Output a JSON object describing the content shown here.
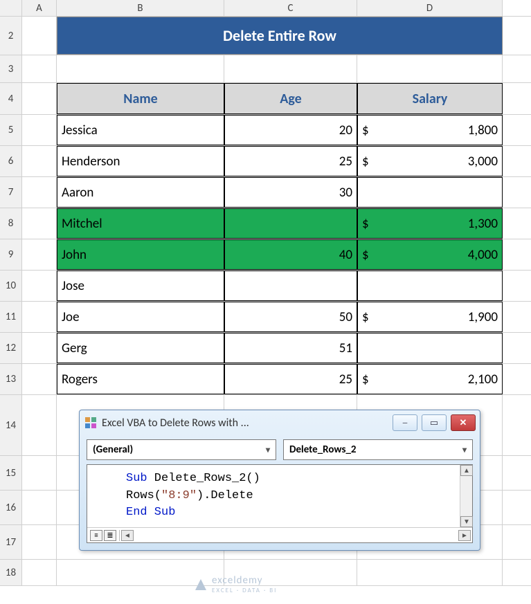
{
  "columns": {
    "a": "A",
    "b": "B",
    "c": "C",
    "d": "D"
  },
  "rowLabels": {
    "r2": "2",
    "r3": "3",
    "r4": "4",
    "r5": "5",
    "r6": "6",
    "r7": "7",
    "r8": "8",
    "r9": "9",
    "r10": "10",
    "r11": "11",
    "r12": "12",
    "r13": "13",
    "r14": "14",
    "r15": "15",
    "r16": "16",
    "r17": "17",
    "r18": "18"
  },
  "title": "Delete Entire Row",
  "headers": {
    "name": "Name",
    "age": "Age",
    "salary": "Salary"
  },
  "rows": [
    {
      "name": "Jessica",
      "age": "20",
      "cur": "$",
      "salary": "1,800",
      "hl": false
    },
    {
      "name": "Henderson",
      "age": "25",
      "cur": "$",
      "salary": "3,000",
      "hl": false
    },
    {
      "name": "Aaron",
      "age": "30",
      "cur": "",
      "salary": "",
      "hl": false
    },
    {
      "name": "Mitchel",
      "age": "",
      "cur": "$",
      "salary": "1,300",
      "hl": true
    },
    {
      "name": "John",
      "age": "40",
      "cur": "$",
      "salary": "4,000",
      "hl": true
    },
    {
      "name": "Jose",
      "age": "",
      "cur": "",
      "salary": "",
      "hl": false
    },
    {
      "name": "Joe",
      "age": "50",
      "cur": "$",
      "salary": "1,900",
      "hl": false
    },
    {
      "name": "Gerg",
      "age": "51",
      "cur": "",
      "salary": "",
      "hl": false
    },
    {
      "name": "Rogers",
      "age": "25",
      "cur": "$",
      "salary": "2,100",
      "hl": false
    }
  ],
  "vba": {
    "title": "Excel VBA to Delete Rows with ...",
    "dropdown1": "(General)",
    "dropdown2": "Delete_Rows_2",
    "code": {
      "line1_kw": "Sub",
      "line1_rest": " Delete_Rows_2()",
      "line2_a": "Rows(",
      "line2_str": "\"8:9\"",
      "line2_b": ").Delete",
      "line3": "End Sub"
    }
  },
  "watermark": {
    "main": "exceldemy",
    "sub": "EXCEL · DATA · BI"
  },
  "chart_data": {
    "type": "table",
    "title": "Delete Entire Row",
    "columns": [
      "Name",
      "Age",
      "Salary"
    ],
    "rows": [
      [
        "Jessica",
        20,
        1800
      ],
      [
        "Henderson",
        25,
        3000
      ],
      [
        "Aaron",
        30,
        null
      ],
      [
        "Mitchel",
        null,
        1300
      ],
      [
        "John",
        40,
        4000
      ],
      [
        "Jose",
        null,
        null
      ],
      [
        "Joe",
        50,
        1900
      ],
      [
        "Gerg",
        51,
        null
      ],
      [
        "Rogers",
        25,
        2100
      ]
    ],
    "highlighted_rows": [
      3,
      4
    ]
  }
}
